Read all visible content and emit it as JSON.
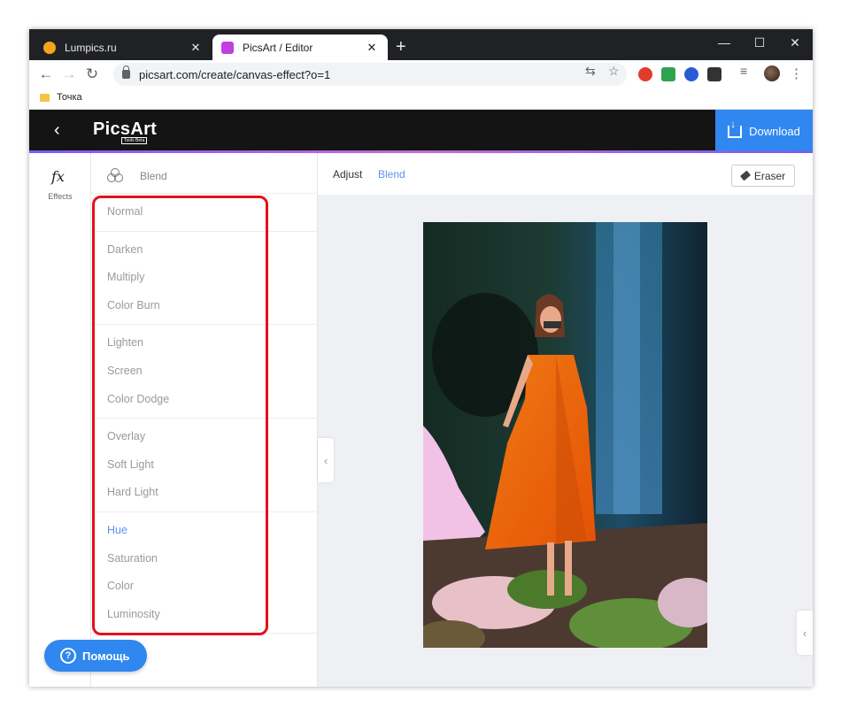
{
  "browser": {
    "tabs": [
      {
        "title": "Lumpics.ru",
        "favicon_color": "#f7a51d",
        "active": false
      },
      {
        "title": "PicsArt / Editor",
        "favicon_color": "#c13ee0",
        "active": true
      }
    ],
    "new_tab": "+",
    "window_controls": {
      "minimize": "—",
      "maximize": "☐",
      "close": "✕"
    },
    "url": "picsart.com/create/canvas-effect?o=1",
    "bookmark": "Точка"
  },
  "app": {
    "logo": "PicsArt",
    "logo_badge": "Tools Beta",
    "download_label": "Download",
    "effects_label": "Effects",
    "panel_title": "Blend",
    "canvas_tabs": {
      "adjust": "Adjust",
      "blend": "Blend"
    },
    "eraser_label": "Eraser",
    "help_label": "Помощь",
    "blend_groups": [
      [
        {
          "label": "Normal"
        }
      ],
      [
        {
          "label": "Darken"
        },
        {
          "label": "Multiply"
        },
        {
          "label": "Color Burn"
        }
      ],
      [
        {
          "label": "Lighten"
        },
        {
          "label": "Screen"
        },
        {
          "label": "Color Dodge"
        }
      ],
      [
        {
          "label": "Overlay"
        },
        {
          "label": "Soft Light"
        },
        {
          "label": "Hard Light"
        }
      ],
      [
        {
          "label": "Hue",
          "selected": true
        },
        {
          "label": "Saturation"
        },
        {
          "label": "Color"
        },
        {
          "label": "Luminosity"
        }
      ]
    ]
  },
  "colors": {
    "accent_blue": "#2f87ef",
    "selected_mode": "#5b94f0",
    "highlight_box": "#e3121a"
  }
}
